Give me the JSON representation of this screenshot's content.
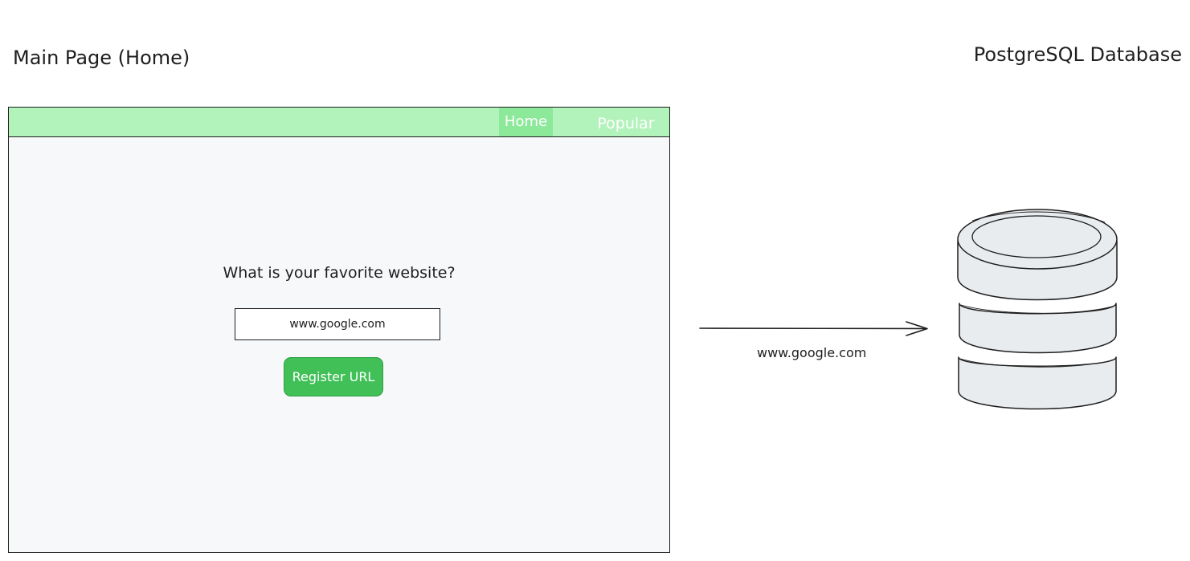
{
  "titles": {
    "main_page": "Main Page (Home)",
    "database": "PostgreSQL Database"
  },
  "navbar": {
    "home": "Home",
    "popular": "Popular"
  },
  "form": {
    "question": "What is your favorite website?",
    "input_value": "www.google.com",
    "button_label": "Register URL"
  },
  "arrow": {
    "label": "www.google.com"
  },
  "colors": {
    "navbar_bg": "#b2f2bb",
    "nav_active_bg": "#8ce99a",
    "button_bg": "#40c057",
    "page_bg": "#f7f8fa",
    "db_fill": "#e9ecef"
  },
  "icons": {
    "database": "database-icon",
    "arrow": "arrow-right-icon"
  }
}
